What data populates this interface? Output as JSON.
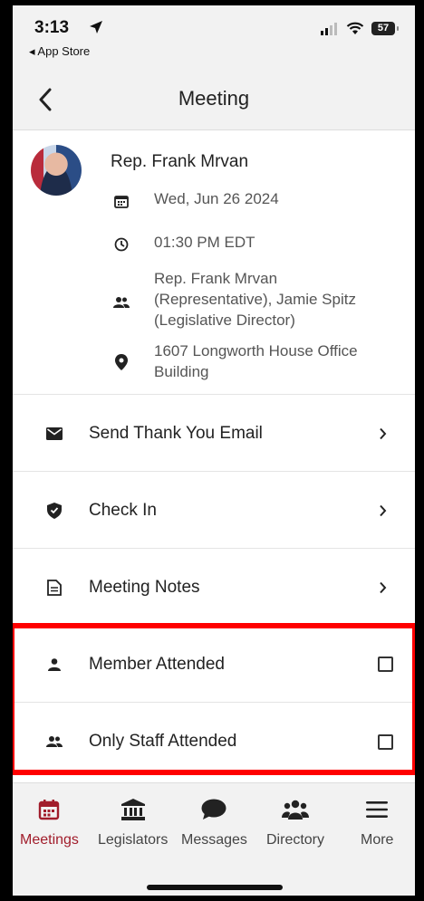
{
  "status_bar": {
    "time": "3:13",
    "back_app": "App Store",
    "battery": "57"
  },
  "nav": {
    "title": "Meeting"
  },
  "meeting": {
    "host": "Rep. Frank Mrvan",
    "date": "Wed, Jun 26 2024",
    "time": "01:30 PM EDT",
    "attendees_line1": "Rep. Frank Mrvan",
    "attendees_line2": "(Representative), Jamie Spitz",
    "attendees_line3": "(Legislative Director)",
    "location_line1": "1607 Longworth House Office",
    "location_line2": "Building"
  },
  "actions": {
    "thank_you": "Send Thank You Email",
    "check_in": "Check In",
    "notes": "Meeting Notes",
    "member_attended": "Member Attended",
    "staff_attended": "Only Staff Attended"
  },
  "tabs": {
    "meetings": "Meetings",
    "legislators": "Legislators",
    "messages": "Messages",
    "directory": "Directory",
    "more": "More"
  },
  "colors": {
    "accent": "#a11d2b",
    "highlight": "#ff0000",
    "bar_bg": "#f2f2f2"
  }
}
